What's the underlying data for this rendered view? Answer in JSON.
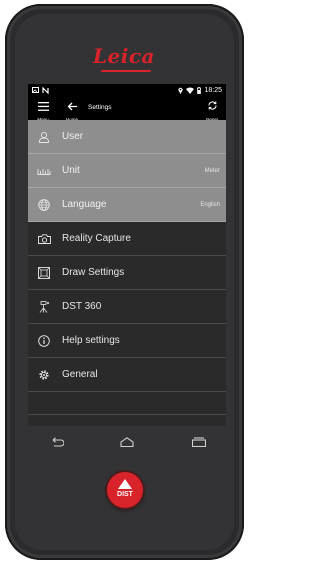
{
  "brand": {
    "logo": "Leica",
    "accent": "#d9232a"
  },
  "status": {
    "time": "18:25"
  },
  "appbar": {
    "menu_label": "Menu",
    "home_label": "Home",
    "title": "Settings",
    "reset_label": "Reset"
  },
  "items": [
    {
      "label": "User",
      "icon": "user-icon",
      "value": ""
    },
    {
      "label": "Unit",
      "icon": "ruler-icon",
      "value": "Meter"
    },
    {
      "label": "Language",
      "icon": "globe-icon",
      "value": "English"
    },
    {
      "label": "Reality Capture",
      "icon": "camera-icon",
      "value": ""
    },
    {
      "label": "Draw Settings",
      "icon": "draw-icon",
      "value": ""
    },
    {
      "label": "DST 360",
      "icon": "tripod-icon",
      "value": ""
    },
    {
      "label": "Help settings",
      "icon": "info-icon",
      "value": ""
    },
    {
      "label": "General",
      "icon": "gear-icon",
      "value": ""
    }
  ],
  "dist_button": {
    "label": "DIST"
  }
}
